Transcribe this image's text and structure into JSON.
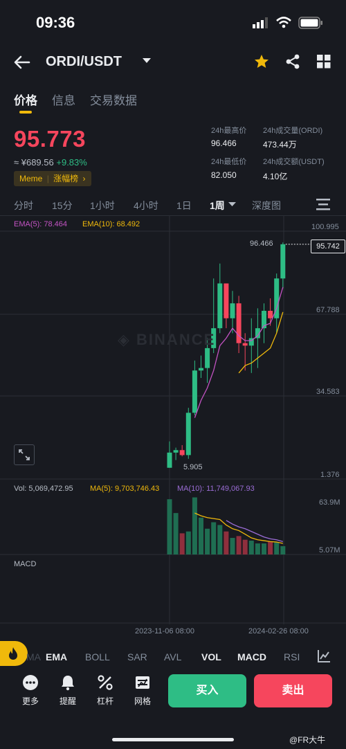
{
  "status": {
    "time": "09:36"
  },
  "header": {
    "pair": "ORDI/USDT"
  },
  "tabs": [
    "价格",
    "信息",
    "交易数据"
  ],
  "price": {
    "last": "95.773",
    "cny": "≈ ¥689.56",
    "change": "+9.83%",
    "tag_a": "Meme",
    "tag_b": "涨幅榜"
  },
  "stats": {
    "high_label": "24h最高价",
    "high": "96.466",
    "vol_label": "24h成交量(ORDI)",
    "vol": "473.44万",
    "low_label": "24h最低价",
    "low": "82.050",
    "amt_label": "24h成交额(USDT)",
    "amt": "4.10亿"
  },
  "timeframes": [
    "分时",
    "15分",
    "1小时",
    "4小时",
    "1日",
    "1周",
    "深度图"
  ],
  "chart_labels": {
    "ema5": "EMA(5): 78.464",
    "ema10": "EMA(10): 68.492",
    "y_ticks": [
      "100.995",
      "67.788",
      "34.583",
      "1.376"
    ],
    "high_mark": "96.466",
    "low_mark": "5.905",
    "last_price_tag": "95.742",
    "watermark": "BINANCE",
    "vol": "Vol: 5,069,472.95",
    "ma5": "MA(5): 9,703,746.43",
    "ma10": "MA(10): 11,749,067.93",
    "vol_ticks": [
      "63.9M",
      "5.07M"
    ],
    "macd": "MACD",
    "dates": [
      "2023-11-06 08:00",
      "2024-02-26 08:00"
    ]
  },
  "indicators": [
    "MA",
    "EMA",
    "BOLL",
    "SAR",
    "AVL",
    "VOL",
    "MACD",
    "RSI"
  ],
  "bottom": {
    "tools": [
      "更多",
      "提醒",
      "杠杆",
      "网格"
    ],
    "buy": "买入",
    "sell": "卖出"
  },
  "footer": {
    "watermark": "@FR大牛"
  },
  "colors": {
    "up": "#2ebd85",
    "down": "#f6465d",
    "accent": "#f0b90b",
    "ema5": "#c353c3",
    "ema10": "#f0b90b",
    "ma10": "#9b6dd6"
  },
  "chart_data": [
    {
      "type": "candlestick",
      "title": "",
      "note": "weekly candles, values approximate (data units USDT)",
      "candles": [
        {
          "o": 5.9,
          "h": 16.5,
          "l": 5.9,
          "c": 12.0
        },
        {
          "o": 12.0,
          "h": 14.0,
          "l": 9.0,
          "c": 13.0
        },
        {
          "o": 13.0,
          "h": 15.0,
          "l": 10.5,
          "c": 11.0
        },
        {
          "o": 11.0,
          "h": 30.0,
          "l": 9.5,
          "c": 28.0
        },
        {
          "o": 28.0,
          "h": 49.0,
          "l": 27.0,
          "c": 45.0
        },
        {
          "o": 45.0,
          "h": 51.0,
          "l": 42.0,
          "c": 46.0
        },
        {
          "o": 46.0,
          "h": 58.0,
          "l": 40.0,
          "c": 54.0
        },
        {
          "o": 54.0,
          "h": 82.0,
          "l": 52.0,
          "c": 62.0
        },
        {
          "o": 62.0,
          "h": 88.0,
          "l": 60.0,
          "c": 80.0
        },
        {
          "o": 80.0,
          "h": 78.0,
          "l": 62.0,
          "c": 66.0
        },
        {
          "o": 66.0,
          "h": 77.0,
          "l": 60.0,
          "c": 72.0
        },
        {
          "o": 72.0,
          "h": 75.0,
          "l": 52.0,
          "c": 56.0
        },
        {
          "o": 56.0,
          "h": 60.0,
          "l": 45.0,
          "c": 55.0
        },
        {
          "o": 55.0,
          "h": 66.0,
          "l": 44.0,
          "c": 58.0
        },
        {
          "o": 58.0,
          "h": 70.0,
          "l": 46.0,
          "c": 62.0
        },
        {
          "o": 62.0,
          "h": 72.0,
          "l": 56.0,
          "c": 69.0
        },
        {
          "o": 69.0,
          "h": 74.0,
          "l": 63.0,
          "c": 66.0
        },
        {
          "o": 66.0,
          "h": 84.0,
          "l": 60.0,
          "c": 82.0
        },
        {
          "o": 82.0,
          "h": 96.466,
          "l": 78.0,
          "c": 95.742
        }
      ],
      "ema5": [
        null,
        null,
        null,
        null,
        26,
        33,
        38,
        45,
        55,
        58,
        62,
        59,
        57,
        57,
        59,
        63,
        64,
        70,
        78.464
      ],
      "ema10": [
        null,
        null,
        null,
        null,
        null,
        null,
        null,
        null,
        null,
        null,
        null,
        44,
        47,
        48,
        50,
        52,
        54,
        60,
        68.492
      ],
      "ylim": [
        1.376,
        100.995
      ]
    },
    {
      "type": "bar",
      "title": "",
      "values_M": [
        60,
        45,
        23,
        25,
        62,
        40,
        28,
        35,
        32,
        25,
        18,
        20,
        16,
        15,
        12,
        12,
        14,
        13,
        9
      ],
      "ma5_M": [
        null,
        null,
        null,
        null,
        45,
        42,
        40,
        39,
        38,
        32,
        28,
        26,
        22,
        18,
        16,
        15,
        14,
        13.5,
        12
      ],
      "ma10_M": [
        null,
        null,
        null,
        null,
        null,
        null,
        null,
        null,
        null,
        37,
        33,
        30,
        28,
        25,
        22,
        19,
        17,
        16,
        14
      ],
      "ylim_M": [
        0,
        63.9
      ]
    }
  ]
}
